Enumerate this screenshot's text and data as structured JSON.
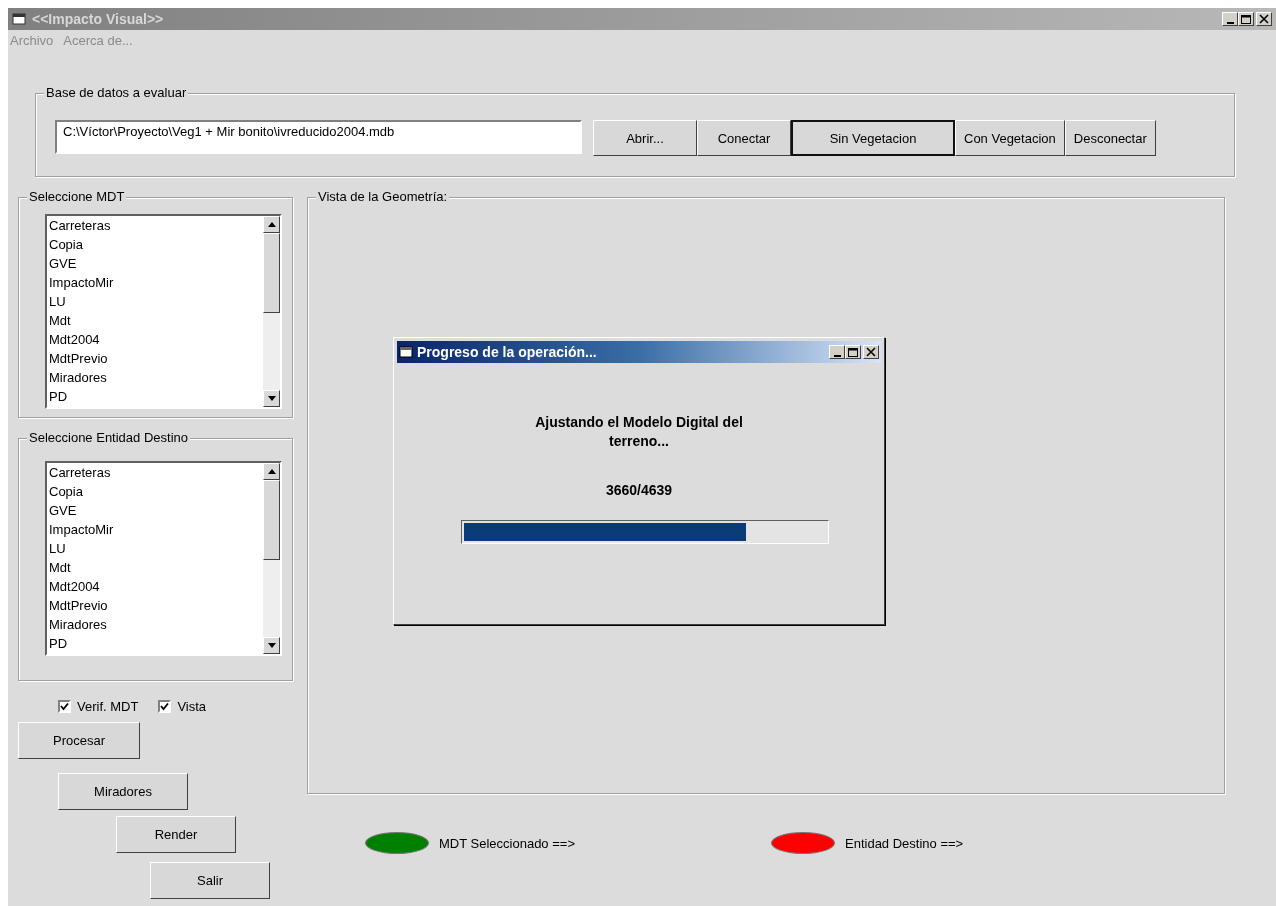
{
  "window": {
    "title": "<<Impacto Visual>>",
    "active": false
  },
  "menu": [
    "Archivo",
    "Acerca de..."
  ],
  "database": {
    "legend": "Base de datos a evaluar",
    "path": "C:\\Víctor\\Proyecto\\Veg1 + Mir bonito\\ivreducido2004.mdb",
    "buttons": [
      {
        "label": "Abrir...",
        "focused": false
      },
      {
        "label": "Conectar",
        "focused": false
      },
      {
        "label": "Sin Vegetacion",
        "focused": true
      },
      {
        "label": "Con Vegetacion",
        "focused": false
      },
      {
        "label": "Desconectar",
        "focused": false
      }
    ]
  },
  "lists": [
    {
      "legend": "Seleccione MDT",
      "items": [
        "Carreteras",
        "Copia",
        "GVE",
        "ImpactoMir",
        "LU",
        "Mdt",
        "Mdt2004",
        "MdtPrevio",
        "Miradores",
        "PD"
      ]
    },
    {
      "legend": "Seleccione Entidad Destino",
      "items": [
        "Carreteras",
        "Copia",
        "GVE",
        "ImpactoMir",
        "LU",
        "Mdt",
        "Mdt2004",
        "MdtPrevio",
        "Miradores",
        "PD"
      ]
    }
  ],
  "checkboxes": [
    {
      "label": "Verif. MDT",
      "checked": true
    },
    {
      "label": "Vista",
      "checked": true
    }
  ],
  "actions": [
    "Procesar",
    "Miradores",
    "Render",
    "Salir"
  ],
  "view": {
    "legend": "Vista de la Geometría:"
  },
  "legend_items": [
    {
      "label": "MDT Seleccionado ==>",
      "color": "#008000"
    },
    {
      "label": "Entidad Destino ==>",
      "color": "#ff0000"
    }
  ],
  "dialog": {
    "title": "Progreso de la operación...",
    "active": true,
    "message": "Ajustando el Modelo Digital del terreno...",
    "count": "3660/4639",
    "level": 0.78
  }
}
